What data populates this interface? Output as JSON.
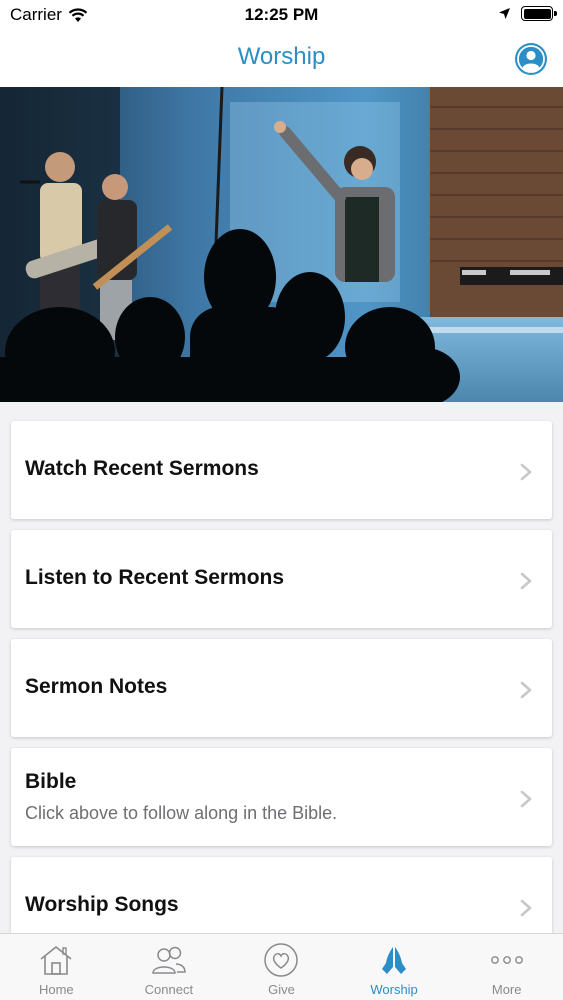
{
  "status_bar": {
    "carrier": "Carrier",
    "time": "12:25 PM"
  },
  "nav": {
    "title": "Worship",
    "accent_color": "#2b8ec6"
  },
  "hero": {
    "icon": "worship-band-photo"
  },
  "menu": [
    {
      "title": "Watch Recent Sermons",
      "subtitle": ""
    },
    {
      "title": "Listen to Recent Sermons",
      "subtitle": ""
    },
    {
      "title": "Sermon Notes",
      "subtitle": ""
    },
    {
      "title": "Bible",
      "subtitle": "Click above to follow along in the Bible."
    },
    {
      "title": "Worship Songs",
      "subtitle": ""
    }
  ],
  "tabs": [
    {
      "label": "Home",
      "icon": "home-icon",
      "active": false
    },
    {
      "label": "Connect",
      "icon": "people-icon",
      "active": false
    },
    {
      "label": "Give",
      "icon": "heart-icon",
      "active": false
    },
    {
      "label": "Worship",
      "icon": "praying-hands-icon",
      "active": true
    },
    {
      "label": "More",
      "icon": "more-icon",
      "active": false
    }
  ]
}
